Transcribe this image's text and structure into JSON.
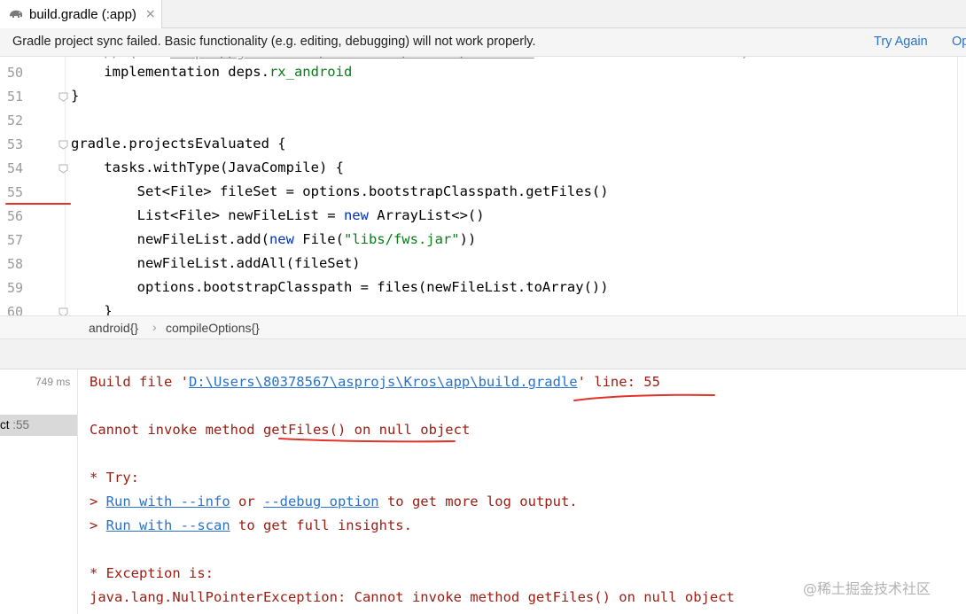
{
  "tab": {
    "label": "build.gradle (:app)",
    "close": "×"
  },
  "banner": {
    "message": "Gradle project sync failed. Basic functionality (e.g. editing, debugging) will not work properly.",
    "try_again": "Try Again",
    "open": "Op"
  },
  "editor": {
    "lines": [
      {
        "num": "50",
        "tokens": [
          {
            "t": "    implementation deps.",
            "c": ""
          },
          {
            "t": "rx_android",
            "c": "mem"
          }
        ]
      },
      {
        "num": "51",
        "tokens": [
          {
            "t": "}",
            "c": ""
          }
        ]
      },
      {
        "num": "52",
        "tokens": []
      },
      {
        "num": "53",
        "tokens": [
          {
            "t": "gradle.projectsEvaluated {",
            "c": ""
          }
        ]
      },
      {
        "num": "54",
        "tokens": [
          {
            "t": "    tasks.withType(JavaCompile) {",
            "c": ""
          }
        ]
      },
      {
        "num": "55",
        "tokens": [
          {
            "t": "        Set<File> fileSet = options.bootstrapClasspath.getFiles()",
            "c": ""
          }
        ]
      },
      {
        "num": "56",
        "tokens": [
          {
            "t": "        List<File> newFileList = ",
            "c": ""
          },
          {
            "t": "new",
            "c": "kw"
          },
          {
            "t": " ArrayList<>()",
            "c": ""
          }
        ]
      },
      {
        "num": "57",
        "tokens": [
          {
            "t": "        newFileList.add(",
            "c": ""
          },
          {
            "t": "new",
            "c": "kw"
          },
          {
            "t": " File(",
            "c": ""
          },
          {
            "t": "\"libs/fws.jar\"",
            "c": "str"
          },
          {
            "t": "))",
            "c": ""
          }
        ]
      },
      {
        "num": "58",
        "tokens": [
          {
            "t": "        newFileList.addAll(fileSet)",
            "c": ""
          }
        ]
      },
      {
        "num": "59",
        "tokens": [
          {
            "t": "        options.bootstrapClasspath = files(newFileList.toArray())",
            "c": ""
          }
        ]
      },
      {
        "num": "60",
        "tokens": [
          {
            "t": "    }",
            "c": ""
          }
        ]
      }
    ]
  },
  "breadcrumb": {
    "item1": "android{}",
    "separator": "›",
    "item2": "compileOptions{}"
  },
  "build": {
    "time": "749 ms",
    "row_label": "ct",
    "row_line": " :55",
    "output": {
      "file_prefix": "Build file '",
      "file_path": "D:\\Users\\80378567\\asprojs\\Kros\\app\\build.gradle",
      "file_suffix": "' line: 55",
      "error_prefix": "Cannot invoke method ",
      "error_method": "getFiles() on null",
      "error_suffix": " object",
      "try_header": "* Try:",
      "try1_prefix": "> ",
      "try1_link": "Run with --info",
      "try1_mid": " or ",
      "try1_link2": "--debug option",
      "try1_suffix": " to get more log output.",
      "try2_prefix": "> ",
      "try2_link": "Run with --scan",
      "try2_suffix": " to get full insights.",
      "exception_header": "* Exception is:",
      "exception_line": "java.lang.NullPointerException: Cannot invoke method getFiles() on null object"
    }
  },
  "watermark": "@稀土掘金技术社区",
  "colors": {
    "keyword": "#0033b3",
    "string": "#067d17",
    "error_text": "#9b1c10",
    "link": "#2a72c9",
    "annotation_red": "#e0342b"
  }
}
